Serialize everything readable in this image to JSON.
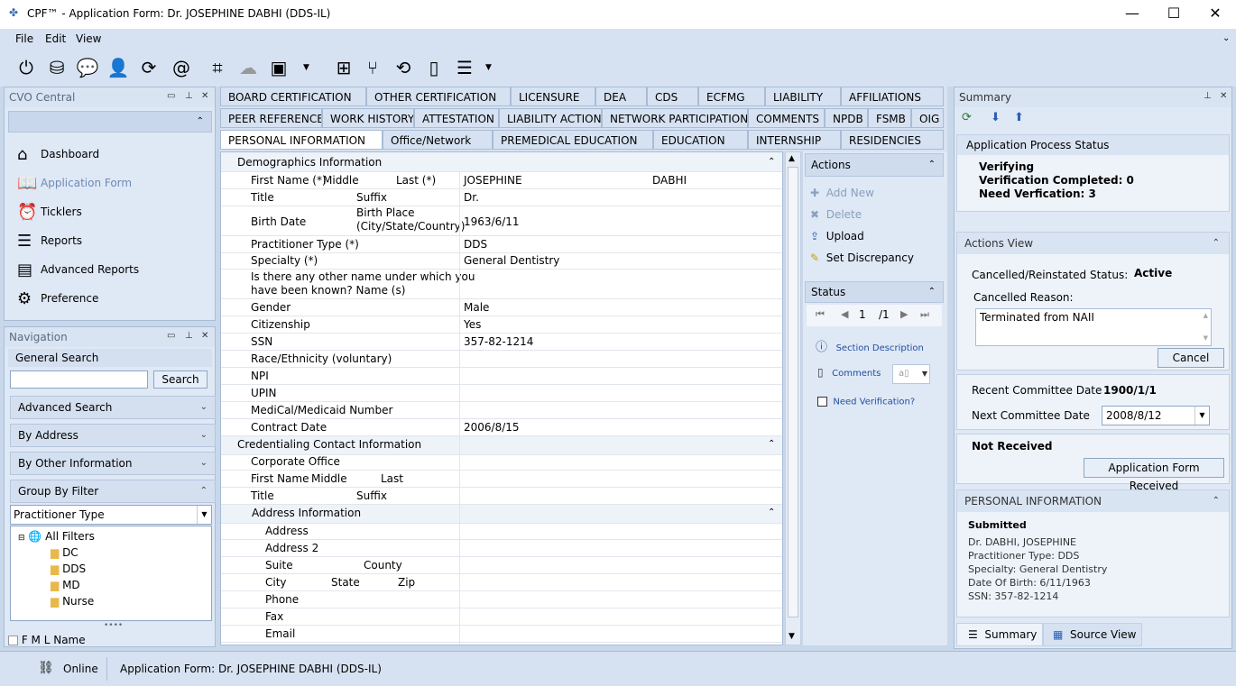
{
  "window": {
    "title": "CPF™  -  Application Form: Dr. JOSEPHINE DABHI  (DDS-IL)"
  },
  "menu": [
    "File",
    "Edit",
    "View"
  ],
  "cvo": {
    "title": "CVO Central",
    "items": [
      "Dashboard",
      "Application Form",
      "Ticklers",
      "Reports",
      "Advanced Reports",
      "Preference"
    ]
  },
  "nav": {
    "title": "Navigation",
    "general": "General Search",
    "search_btn": "Search",
    "sections": [
      "Advanced Search",
      "By Address",
      "By Other Information",
      "Group By Filter"
    ],
    "filter_value": "Practitioner Type",
    "tree_root": "All Filters",
    "tree_items": [
      "DC",
      "DDS",
      "MD",
      "Nurse"
    ],
    "fml": "F M L Name"
  },
  "tabs": {
    "row1": [
      "BOARD CERTIFICATION",
      "OTHER CERTIFICATION",
      "LICENSURE",
      "DEA",
      "CDS",
      "ECFMG",
      "LIABILITY",
      "AFFILIATIONS"
    ],
    "row2": [
      "PEER REFERENCES",
      "WORK HISTORY",
      "ATTESTATION",
      "LIABILITY ACTION",
      "NETWORK PARTICIPATION",
      "COMMENTS",
      "NPDB",
      "FSMB",
      "OIG"
    ],
    "row3": [
      "PERSONAL INFORMATION",
      "Office/Network",
      "PREMEDICAL EDUCATION",
      "EDUCATION",
      "INTERNSHIP",
      "RESIDENCIES"
    ]
  },
  "form": {
    "demo_title": "Demographics Information",
    "first_name_lbl": "First Name (*)",
    "middle_lbl": "Middle",
    "last_lbl": "Last (*)",
    "first_name": "JOSEPHINE",
    "last_name": "DABHI",
    "title_lbl": "Title",
    "suffix_lbl": "Suffix",
    "title_val": "Dr.",
    "birth_date_lbl": "Birth Date",
    "birth_place_lbl": "Birth Place",
    "birth_place_lbl2": "(City/State/Country)",
    "birth_date": "1963/6/11",
    "ptype_lbl": "Practitioner Type (*)",
    "ptype": "DDS",
    "specialty_lbl": "Specialty (*)",
    "specialty": "General Dentistry",
    "other_name_lbl": "Is there any other name under which you",
    "other_name_lbl2": "have been known? Name (s)",
    "gender_lbl": "Gender",
    "gender": "Male",
    "citizen_lbl": "Citizenship",
    "citizen": "Yes",
    "ssn_lbl": "SSN",
    "ssn": "357-82-1214",
    "race_lbl": "Race/Ethnicity (voluntary)",
    "npi_lbl": "NPI",
    "upin_lbl": "UPIN",
    "medical_lbl": "MediCal/Medicaid Number",
    "contract_lbl": "Contract Date",
    "contract": "2006/8/15",
    "cred_title": "Credentialing Contact Information",
    "corp_lbl": "Corporate Office",
    "first2_lbl": "First Name",
    "middle2_lbl": "Middle",
    "last2_lbl": "Last",
    "title2_lbl": "Title",
    "suffix2_lbl": "Suffix",
    "addr_title": "Address Information",
    "address_lbl": "Address",
    "address2_lbl": "Address 2",
    "suite_lbl": "Suite",
    "county_lbl": "County",
    "city_lbl": "City",
    "state_lbl": "State",
    "zip_lbl": "Zip",
    "phone_lbl": "Phone",
    "fax_lbl": "Fax",
    "email_lbl": "Email"
  },
  "actions": {
    "title": "Actions",
    "add": "Add New",
    "delete": "Delete",
    "upload": "Upload",
    "discrepancy": "Set Discrepancy"
  },
  "status": {
    "title": "Status",
    "page": "1",
    "of": "/1",
    "section_desc": "Section Description",
    "comments": "Comments",
    "need_verif": "Need Verification?"
  },
  "summary": {
    "title": "Summary",
    "process_title": "Application Process Status",
    "verifying": "Verifying",
    "completed": "Verification Completed: 0",
    "need": "Need Verfication: 3",
    "actions_view": "Actions View",
    "cancel_status_lbl": "Cancelled/Reinstated Status:",
    "cancel_status": "Active",
    "cancel_reason_lbl": "Cancelled Reason:",
    "cancel_reason": "Terminated from NAII",
    "cancel_btn": "Cancel",
    "recent_lbl": "Recent Committee Date",
    "recent": "1900/1/1",
    "next_lbl": "Next Committee Date",
    "next": "2008/8/12",
    "not_received": "Not Received",
    "received_btn": "Application Form Received",
    "pi_title": "PERSONAL INFORMATION",
    "submitted": "Submitted",
    "pi_lines": [
      "Dr. DABHI, JOSEPHINE",
      "Practitioner Type: DDS",
      "Specialty: General Dentistry",
      "Date Of Birth: 6/11/1963",
      "SSN: 357-82-1214"
    ],
    "tab_summary": "Summary",
    "tab_source": "Source View"
  },
  "statusbar": {
    "online": "Online",
    "doc": "Application Form: Dr. JOSEPHINE DABHI  (DDS-IL)"
  }
}
